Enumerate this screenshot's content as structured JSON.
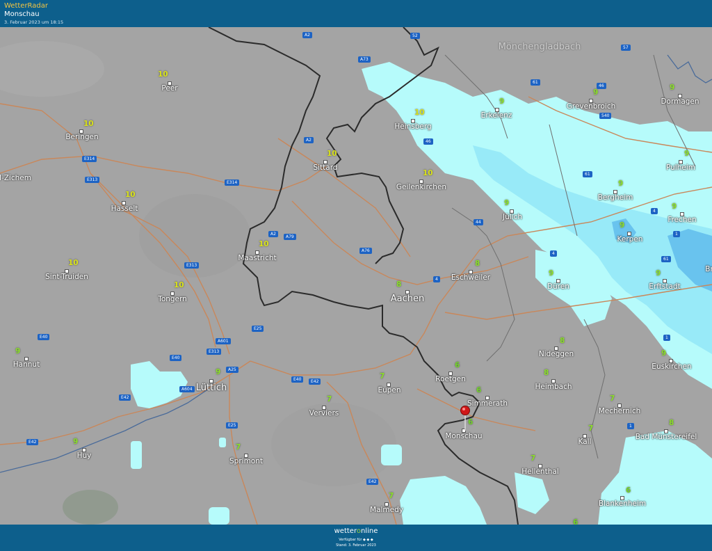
{
  "header": {
    "app_name": "WetterRadar",
    "location": "Monschau",
    "timestamp": "3. Februar 2023 um 18:15"
  },
  "footer": {
    "brand_prefix": "wetter",
    "brand_o": "o",
    "brand_suffix": "nline",
    "apps_text": "Verfügbar für ◆ ◆ ◆",
    "stand": "Stand: 3. Februar 2023"
  },
  "map": {
    "colors": {
      "background": "#a4a4a4",
      "rain_light": "#b6fbfb",
      "rain_medium": "#7fdcf5",
      "rain_heavy": "#4aa8e8",
      "border": "#2b2b2b",
      "roads": "#c9875a",
      "rivers": "#4a6b9a",
      "shield": "#1d63c4",
      "pin": "#d01818"
    },
    "selected_location": "Monschau",
    "cities": [
      {
        "name": "Peer",
        "temp": "10"
      },
      {
        "name": "Beringen",
        "temp": "10"
      },
      {
        "name": "l-Zichem",
        "temp": ""
      },
      {
        "name": "Hasselt",
        "temp": "10"
      },
      {
        "name": "Sint-Truiden",
        "temp": "10"
      },
      {
        "name": "Tongern",
        "temp": "10"
      },
      {
        "name": "Hannut",
        "temp": "9"
      },
      {
        "name": "Lüttich",
        "temp": "9"
      },
      {
        "name": "Huy",
        "temp": "9"
      },
      {
        "name": "Sprimont",
        "temp": "7"
      },
      {
        "name": "Verviers",
        "temp": "7"
      },
      {
        "name": "Eupen",
        "temp": "7"
      },
      {
        "name": "Malmedy",
        "temp": "7"
      },
      {
        "name": "Maastricht",
        "temp": "10"
      },
      {
        "name": "Sittard",
        "temp": "10"
      },
      {
        "name": "Heinsberg",
        "temp": "10"
      },
      {
        "name": "Geilenkirchen",
        "temp": "10"
      },
      {
        "name": "Mönchengladbach",
        "temp": ""
      },
      {
        "name": "Erkelenz",
        "temp": "9"
      },
      {
        "name": "Grevenbroich",
        "temp": "9"
      },
      {
        "name": "Dormagen",
        "temp": "9"
      },
      {
        "name": "Pulheim",
        "temp": "9"
      },
      {
        "name": "Bergheim",
        "temp": "9"
      },
      {
        "name": "Frechen",
        "temp": "9"
      },
      {
        "name": "Kerpen",
        "temp": "9"
      },
      {
        "name": "Jülich",
        "temp": "9"
      },
      {
        "name": "Aachen",
        "temp": "8"
      },
      {
        "name": "Eschweiler",
        "temp": "8"
      },
      {
        "name": "Düren",
        "temp": "9"
      },
      {
        "name": "Erftstadt",
        "temp": "9"
      },
      {
        "name": "Nideggen",
        "temp": "8"
      },
      {
        "name": "Euskirchen",
        "temp": "9"
      },
      {
        "name": "Roetgen",
        "temp": "6"
      },
      {
        "name": "Simmerath",
        "temp": "6"
      },
      {
        "name": "Monschau",
        "temp": "6"
      },
      {
        "name": "Heimbach",
        "temp": "8"
      },
      {
        "name": "Mechernich",
        "temp": "7"
      },
      {
        "name": "Kall",
        "temp": "7"
      },
      {
        "name": "Bad Münstereifel",
        "temp": "8"
      },
      {
        "name": "Hellenthal",
        "temp": "7"
      },
      {
        "name": "Blankenheim",
        "temp": "6"
      },
      {
        "name": "Br",
        "temp": ""
      }
    ],
    "extra_temp": "6",
    "road_shields": [
      "A2",
      "52",
      "A73",
      "57",
      "61",
      "46",
      "540",
      "46",
      "A2",
      "E314",
      "E313",
      "E314",
      "A2",
      "A79",
      "44",
      "61",
      "4",
      "A76",
      "4",
      "1",
      "61",
      "4",
      "E313",
      "E25",
      "E40",
      "A601",
      "E40",
      "E313",
      "A25",
      "A604",
      "E40",
      "E42",
      "E42",
      "E25",
      "E42",
      "E42",
      "1",
      "1"
    ]
  }
}
